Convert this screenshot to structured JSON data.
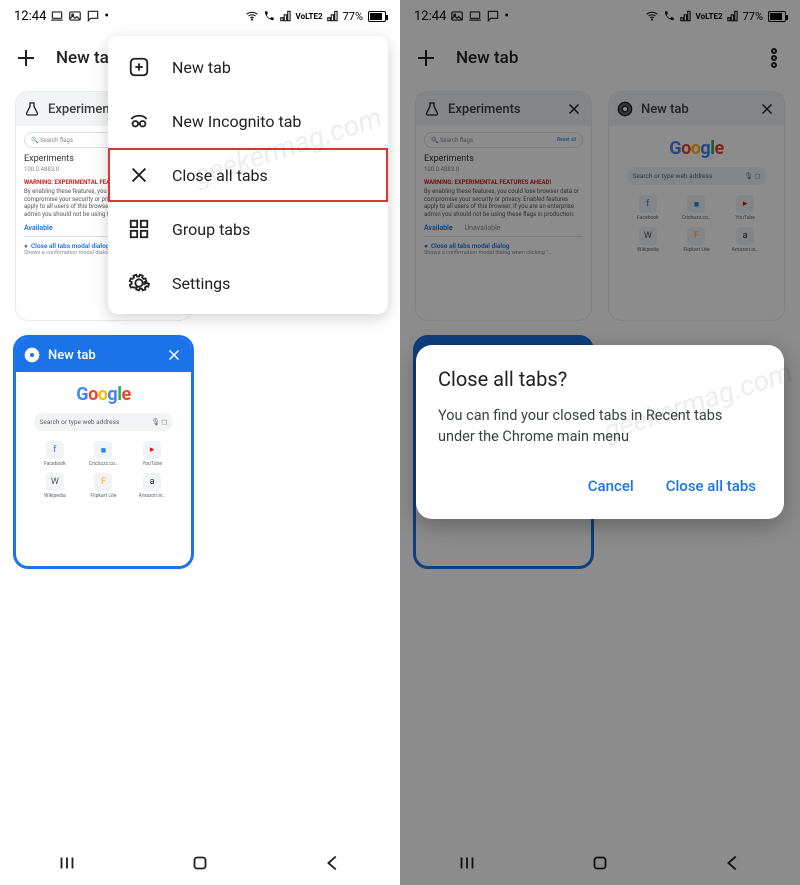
{
  "status": {
    "time": "12:44",
    "battery": "77%",
    "net_label": "VoLTE2"
  },
  "watermark": "geekermag.com",
  "left": {
    "toolbar": {
      "new_tab": "New tab"
    },
    "tabs": {
      "experiments": {
        "title": "Experiments",
        "search_placeholder": "Search flags",
        "heading": "Experiments",
        "version": "100.0.4883.0",
        "warning": "WARNING: EXPERIMENTAL FEATURES AHEAD!",
        "description": "By enabling these features, you could lose browser data or compromise your security or privacy. Enabled features apply to all users of this browser. If you are an enterprise admin you should not be using these flags in production.",
        "tab_available": "Available",
        "flag_title": "Close all tabs modal dialog",
        "flag_sub": "Shows a confirmation modal dialog when clicking \"…"
      },
      "newtab": {
        "title": "New tab",
        "search_placeholder": "Search or type web address",
        "tiles": [
          {
            "label": "Facebook",
            "icon": "f",
            "color": "#1877F2"
          },
          {
            "label": "Cricbuzz.co…",
            "icon": "■",
            "color": "#1E88E5"
          },
          {
            "label": "YouTube",
            "icon": "▸",
            "color": "#FF0000"
          },
          {
            "label": "Wikipedia",
            "icon": "W",
            "color": "#555"
          },
          {
            "label": "Flipkart Lite",
            "icon": "F",
            "color": "#F9A825"
          },
          {
            "label": "Amazon.in…",
            "icon": "a",
            "color": "#222"
          }
        ]
      }
    },
    "menu": {
      "new_tab": "New tab",
      "incognito": "New Incognito tab",
      "close_all": "Close all tabs",
      "group": "Group tabs",
      "settings": "Settings"
    }
  },
  "right": {
    "toolbar": {
      "new_tab": "New tab"
    },
    "tabs": {
      "experiments": {
        "title": "Experiments",
        "search_placeholder": "Search flags",
        "reset_label": "Reset all",
        "heading": "Experiments",
        "version": "100.0.4883.0",
        "warning": "WARNING: EXPERIMENTAL FEATURES AHEAD!",
        "description": "By enabling these features, you could lose browser data or compromise your security or privacy. Enabled features apply to all users of this browser. If you are an enterprise admin you should not be using these flags in production.",
        "tab_available": "Available",
        "tab_unavailable": "Unavailable",
        "flag_title": "Close all tabs modal dialog",
        "flag_sub": "Shows a confirmation modal dialog when clicking \"…"
      },
      "newtab": {
        "title": "New tab",
        "search_placeholder": "Search or type web address",
        "tiles": [
          {
            "label": "Facebook",
            "icon": "f",
            "color": "#1877F2"
          },
          {
            "label": "Cricbuzz.co…",
            "icon": "■",
            "color": "#1E88E5"
          },
          {
            "label": "YouTube",
            "icon": "▸",
            "color": "#FF0000"
          },
          {
            "label": "Wikipedia",
            "icon": "W",
            "color": "#555"
          },
          {
            "label": "Flipkart Lite",
            "icon": "F",
            "color": "#F9A825"
          },
          {
            "label": "Amazon.in…",
            "icon": "a",
            "color": "#222"
          }
        ]
      }
    },
    "dialog": {
      "title": "Close all tabs?",
      "message": "You can find your closed tabs in Recent tabs under the Chrome main menu",
      "cancel": "Cancel",
      "confirm": "Close all tabs"
    }
  }
}
